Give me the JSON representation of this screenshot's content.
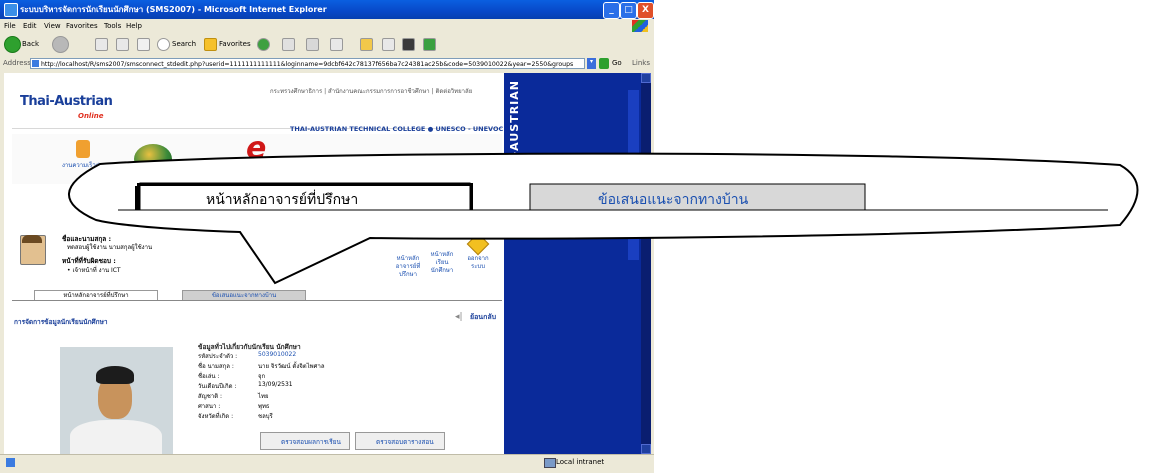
{
  "window": {
    "title": "ระบบบริหารจัดการนักเรียนนักศึกษา (SMS2007) - Microsoft Internet Explorer",
    "controls": [
      "_",
      "□",
      "X"
    ]
  },
  "menu": [
    "File",
    "Edit",
    "View",
    "Favorites",
    "Tools",
    "Help"
  ],
  "toolbar": {
    "back": "Back",
    "search": "Search",
    "favorites": "Favorites"
  },
  "address": {
    "label": "Address",
    "url": "http://localhost/R/sms2007/smsconnect_stdedit.php?userid=1111111111111&loginname=9dcbf642c78137f656ba7c24381ac25b&code=5039010022&year=2550&groups",
    "go": "Go",
    "links": "Links"
  },
  "page": {
    "toplinks": "กระทรวงศึกษาธิการ | สำนักงานคณะกรรมการการอาชีวศึกษา | ติดต่อวิทยาลัย",
    "logo_main": "Thai-Austrian",
    "logo_sub": "Online",
    "college": "THAI-AUSTRIAN TECHNICAL COLLEGE ● UNESCO - UNEVOC",
    "banner_caption": "งานความเร็วต่อ",
    "side_panel_text": "-AUSTRIAN",
    "user": {
      "name_label": "ชื่อและนามสกุล :",
      "name_value": "ทดสอบผู้ใช้งาน นามสกุลผู้ใช้งาน",
      "duty_label": "หน้าที่ที่รับผิดชอบ :",
      "duty_value": "• เจ้าหน้าที่ งาน ICT"
    },
    "nav_links": [
      {
        "label": "หน้าหลักอาจารย์ที่ปรึกษา"
      },
      {
        "label": "หน้าหลักเรียน นักศึกษา"
      },
      {
        "label": "ออกจากระบบ"
      }
    ],
    "tabs": [
      {
        "label": "หน้าหลักอาจารย์ที่ปรึกษา",
        "active": true
      },
      {
        "label": "ข้อเสนอแนะจากทางบ้าน",
        "active": false
      }
    ],
    "section_title": "การจัดการข้อมูลนักเรียนนักศึกษา",
    "back_label": "ย้อนกลับ",
    "info": {
      "heading": "ข้อมูลทั่วไปเกี่ยวกับนักเรียน นักศึกษา",
      "rows": [
        {
          "label": "รหัสประจำตัว :",
          "value": "5039010022",
          "link": true
        },
        {
          "label": "ชื่อ นามสกุล :",
          "value": "นาย จิรวัฒน์ ตั้งจิตไพศาล",
          "link": false
        },
        {
          "label": "ชื่อเล่น :",
          "value": "จุก",
          "link": false
        },
        {
          "label": "วันเดือนปีเกิด :",
          "value": "13/09/2531",
          "link": false
        },
        {
          "label": "สัญชาติ :",
          "value": "ไทย",
          "link": false
        },
        {
          "label": "ศาสนา :",
          "value": "พุทธ",
          "link": false
        },
        {
          "label": "จังหวัดที่เกิด :",
          "value": "ชลบุรี",
          "link": false
        }
      ]
    },
    "buttons": {
      "grades": "ตรวจสอบผลการเรียน",
      "schedule": "ตรวจสอบตารางสอน"
    }
  },
  "status": {
    "zone": "Local intranet"
  },
  "callout": {
    "tab_active": "หน้าหลักอาจารย์ที่ปรึกษา",
    "tab_inactive": "ข้อเสนอแนะจากทางบ้าน"
  },
  "colors": {
    "titlebar": "#0848c8",
    "side_panel": "#0a2a9a",
    "link": "#1a4fb0",
    "tab_inactive_bg": "#cfcfcf"
  }
}
